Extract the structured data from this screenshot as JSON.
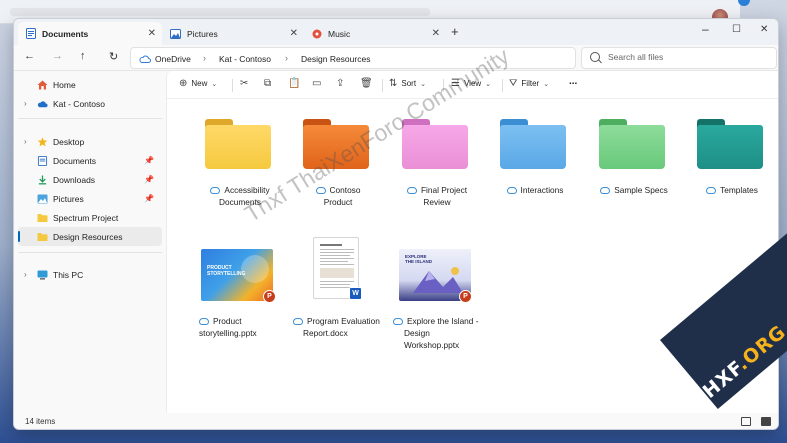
{
  "tabs": [
    {
      "label": "Documents",
      "active": true
    },
    {
      "label": "Pictures",
      "active": false
    },
    {
      "label": "Music",
      "active": false
    }
  ],
  "breadcrumb": [
    "OneDrive",
    "Kat - Contoso",
    "Design Resources"
  ],
  "search": {
    "placeholder": "Search all files"
  },
  "commands": {
    "new": "New",
    "sort": "Sort",
    "view": "View",
    "filter": "Filter",
    "more": "..."
  },
  "sidebar": {
    "items": [
      {
        "label": "Home",
        "icon": "home-icon"
      },
      {
        "label": "Kat - Contoso",
        "icon": "onedrive-cloud-icon"
      },
      {
        "label": "Desktop",
        "icon": "desktop-icon"
      },
      {
        "label": "Documents",
        "icon": "documents-icon",
        "pinned": true
      },
      {
        "label": "Downloads",
        "icon": "download-icon",
        "pinned": true
      },
      {
        "label": "Pictures",
        "icon": "pictures-icon",
        "pinned": true
      },
      {
        "label": "Spectrum Project",
        "icon": "folder-icon"
      },
      {
        "label": "Design Resources",
        "icon": "folder-icon",
        "selected": true
      },
      {
        "label": "This PC",
        "icon": "computer-icon"
      }
    ]
  },
  "folders": [
    {
      "line1": "Accessibility",
      "line2": "Documents",
      "color": "#f5c93f"
    },
    {
      "line1": "Contoso",
      "line2": "Product",
      "color": "#e86a1c"
    },
    {
      "line1": "Final Project",
      "line2": "Review",
      "color": "#e98fd6"
    },
    {
      "line1": "Interactions",
      "line2": "",
      "color": "#5aa8e6"
    },
    {
      "line1": "Sample Specs",
      "line2": "",
      "color": "#69c97b"
    },
    {
      "line1": "Templates",
      "line2": "",
      "color": "#1e8f86"
    }
  ],
  "files": [
    {
      "line1": "Product",
      "line2": "storytelling.pptx",
      "line3": "",
      "thumb_text": "PRODUCT STORYTELLING",
      "type_badge": "P"
    },
    {
      "line1": "Program Evaluation",
      "line2": "Report.docx",
      "line3": "",
      "type_badge": "W"
    },
    {
      "line1": "Explore the Island -",
      "line2": "Design",
      "line3": "Workshop.pptx",
      "thumb_text": "EXPLORE THE ISLAND",
      "type_badge": "P"
    }
  ],
  "status": {
    "count": "14 items"
  },
  "watermark": "Thxf ThaiXenForo Community",
  "corner_brand": {
    "main": "THXF",
    "suffix": ".ORG"
  }
}
